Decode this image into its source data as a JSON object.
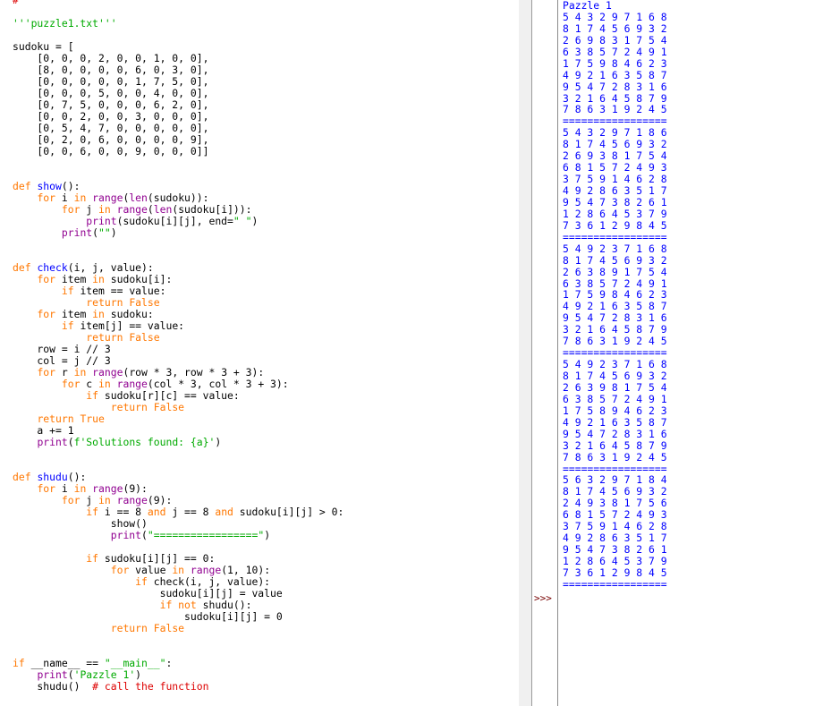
{
  "editor": {
    "code_lines": [
      [
        {
          "t": "# '''",
          "c": "com"
        }
      ],
      [
        {
          "t": "",
          "c": ""
        }
      ],
      [
        {
          "t": "'''puzzle1.txt'''",
          "c": "str"
        }
      ],
      [
        {
          "t": "",
          "c": ""
        }
      ],
      [
        {
          "t": "sudoku = [",
          "c": ""
        }
      ],
      [
        {
          "t": "    [0, 0, 0, 2, 0, 0, 1, 0, 0],",
          "c": ""
        }
      ],
      [
        {
          "t": "    [8, 0, 0, 0, 0, 6, 0, 3, 0],",
          "c": ""
        }
      ],
      [
        {
          "t": "    [0, 0, 0, 0, 0, 1, 7, 5, 0],",
          "c": ""
        }
      ],
      [
        {
          "t": "    [0, 0, 0, 5, 0, 0, 4, 0, 0],",
          "c": ""
        }
      ],
      [
        {
          "t": "    [0, 7, 5, 0, 0, 0, 6, 2, 0],",
          "c": ""
        }
      ],
      [
        {
          "t": "    [0, 0, 2, 0, 0, 3, 0, 0, 0],",
          "c": ""
        }
      ],
      [
        {
          "t": "    [0, 5, 4, 7, 0, 0, 0, 0, 0],",
          "c": ""
        }
      ],
      [
        {
          "t": "    [0, 2, 0, 6, 0, 0, 0, 0, 9],",
          "c": ""
        }
      ],
      [
        {
          "t": "    [0, 0, 6, 0, 0, 9, 0, 0, 0]]",
          "c": ""
        }
      ],
      [
        {
          "t": "",
          "c": ""
        }
      ],
      [
        {
          "t": "",
          "c": ""
        }
      ],
      [
        {
          "t": "def",
          "c": "kw"
        },
        {
          "t": " ",
          "c": ""
        },
        {
          "t": "show",
          "c": "def"
        },
        {
          "t": "():",
          "c": ""
        }
      ],
      [
        {
          "t": "    ",
          "c": ""
        },
        {
          "t": "for",
          "c": "kw"
        },
        {
          "t": " i ",
          "c": ""
        },
        {
          "t": "in",
          "c": "kw"
        },
        {
          "t": " ",
          "c": ""
        },
        {
          "t": "range",
          "c": "bi"
        },
        {
          "t": "(",
          "c": ""
        },
        {
          "t": "len",
          "c": "bi"
        },
        {
          "t": "(sudoku)):",
          "c": ""
        }
      ],
      [
        {
          "t": "        ",
          "c": ""
        },
        {
          "t": "for",
          "c": "kw"
        },
        {
          "t": " j ",
          "c": ""
        },
        {
          "t": "in",
          "c": "kw"
        },
        {
          "t": " ",
          "c": ""
        },
        {
          "t": "range",
          "c": "bi"
        },
        {
          "t": "(",
          "c": ""
        },
        {
          "t": "len",
          "c": "bi"
        },
        {
          "t": "(sudoku[i])):",
          "c": ""
        }
      ],
      [
        {
          "t": "            ",
          "c": ""
        },
        {
          "t": "print",
          "c": "bi"
        },
        {
          "t": "(sudoku[i][j], end=",
          "c": ""
        },
        {
          "t": "\" \"",
          "c": "str"
        },
        {
          "t": ")",
          "c": ""
        }
      ],
      [
        {
          "t": "        ",
          "c": ""
        },
        {
          "t": "print",
          "c": "bi"
        },
        {
          "t": "(",
          "c": ""
        },
        {
          "t": "\"\"",
          "c": "str"
        },
        {
          "t": ")",
          "c": ""
        }
      ],
      [
        {
          "t": "",
          "c": ""
        }
      ],
      [
        {
          "t": "",
          "c": ""
        }
      ],
      [
        {
          "t": "def",
          "c": "kw"
        },
        {
          "t": " ",
          "c": ""
        },
        {
          "t": "check",
          "c": "def"
        },
        {
          "t": "(i, j, value):",
          "c": ""
        }
      ],
      [
        {
          "t": "    ",
          "c": ""
        },
        {
          "t": "for",
          "c": "kw"
        },
        {
          "t": " item ",
          "c": ""
        },
        {
          "t": "in",
          "c": "kw"
        },
        {
          "t": " sudoku[i]:",
          "c": ""
        }
      ],
      [
        {
          "t": "        ",
          "c": ""
        },
        {
          "t": "if",
          "c": "kw"
        },
        {
          "t": " item == value:",
          "c": ""
        }
      ],
      [
        {
          "t": "            ",
          "c": ""
        },
        {
          "t": "return",
          "c": "kw"
        },
        {
          "t": " ",
          "c": ""
        },
        {
          "t": "False",
          "c": "kw"
        }
      ],
      [
        {
          "t": "    ",
          "c": ""
        },
        {
          "t": "for",
          "c": "kw"
        },
        {
          "t": " item ",
          "c": ""
        },
        {
          "t": "in",
          "c": "kw"
        },
        {
          "t": " sudoku:",
          "c": ""
        }
      ],
      [
        {
          "t": "        ",
          "c": ""
        },
        {
          "t": "if",
          "c": "kw"
        },
        {
          "t": " item[j] == value:",
          "c": ""
        }
      ],
      [
        {
          "t": "            ",
          "c": ""
        },
        {
          "t": "return",
          "c": "kw"
        },
        {
          "t": " ",
          "c": ""
        },
        {
          "t": "False",
          "c": "kw"
        }
      ],
      [
        {
          "t": "    row = i // 3",
          "c": ""
        }
      ],
      [
        {
          "t": "    col = j // 3",
          "c": ""
        }
      ],
      [
        {
          "t": "    ",
          "c": ""
        },
        {
          "t": "for",
          "c": "kw"
        },
        {
          "t": " r ",
          "c": ""
        },
        {
          "t": "in",
          "c": "kw"
        },
        {
          "t": " ",
          "c": ""
        },
        {
          "t": "range",
          "c": "bi"
        },
        {
          "t": "(row * 3, row * 3 + 3):",
          "c": ""
        }
      ],
      [
        {
          "t": "        ",
          "c": ""
        },
        {
          "t": "for",
          "c": "kw"
        },
        {
          "t": " c ",
          "c": ""
        },
        {
          "t": "in",
          "c": "kw"
        },
        {
          "t": " ",
          "c": ""
        },
        {
          "t": "range",
          "c": "bi"
        },
        {
          "t": "(col * 3, col * 3 + 3):",
          "c": ""
        }
      ],
      [
        {
          "t": "            ",
          "c": ""
        },
        {
          "t": "if",
          "c": "kw"
        },
        {
          "t": " sudoku[r][c] == value:",
          "c": ""
        }
      ],
      [
        {
          "t": "                ",
          "c": ""
        },
        {
          "t": "return",
          "c": "kw"
        },
        {
          "t": " ",
          "c": ""
        },
        {
          "t": "False",
          "c": "kw"
        }
      ],
      [
        {
          "t": "    ",
          "c": ""
        },
        {
          "t": "return",
          "c": "kw"
        },
        {
          "t": " ",
          "c": ""
        },
        {
          "t": "True",
          "c": "kw"
        }
      ],
      [
        {
          "t": "    a += 1",
          "c": ""
        }
      ],
      [
        {
          "t": "    ",
          "c": ""
        },
        {
          "t": "print",
          "c": "bi"
        },
        {
          "t": "(",
          "c": ""
        },
        {
          "t": "f'Solutions found: {a}'",
          "c": "str"
        },
        {
          "t": ")",
          "c": ""
        }
      ],
      [
        {
          "t": "",
          "c": ""
        }
      ],
      [
        {
          "t": "",
          "c": ""
        }
      ],
      [
        {
          "t": "def",
          "c": "kw"
        },
        {
          "t": " ",
          "c": ""
        },
        {
          "t": "shudu",
          "c": "def"
        },
        {
          "t": "():",
          "c": ""
        }
      ],
      [
        {
          "t": "    ",
          "c": ""
        },
        {
          "t": "for",
          "c": "kw"
        },
        {
          "t": " i ",
          "c": ""
        },
        {
          "t": "in",
          "c": "kw"
        },
        {
          "t": " ",
          "c": ""
        },
        {
          "t": "range",
          "c": "bi"
        },
        {
          "t": "(9):",
          "c": ""
        }
      ],
      [
        {
          "t": "        ",
          "c": ""
        },
        {
          "t": "for",
          "c": "kw"
        },
        {
          "t": " j ",
          "c": ""
        },
        {
          "t": "in",
          "c": "kw"
        },
        {
          "t": " ",
          "c": ""
        },
        {
          "t": "range",
          "c": "bi"
        },
        {
          "t": "(9):",
          "c": ""
        }
      ],
      [
        {
          "t": "            ",
          "c": ""
        },
        {
          "t": "if",
          "c": "kw"
        },
        {
          "t": " i == 8 ",
          "c": ""
        },
        {
          "t": "and",
          "c": "kw"
        },
        {
          "t": " j == 8 ",
          "c": ""
        },
        {
          "t": "and",
          "c": "kw"
        },
        {
          "t": " sudoku[i][j] > 0:",
          "c": ""
        }
      ],
      [
        {
          "t": "                show()",
          "c": ""
        }
      ],
      [
        {
          "t": "                ",
          "c": ""
        },
        {
          "t": "print",
          "c": "bi"
        },
        {
          "t": "(",
          "c": ""
        },
        {
          "t": "\"=================\"",
          "c": "str"
        },
        {
          "t": ")",
          "c": ""
        }
      ],
      [
        {
          "t": "",
          "c": ""
        }
      ],
      [
        {
          "t": "            ",
          "c": ""
        },
        {
          "t": "if",
          "c": "kw"
        },
        {
          "t": " sudoku[i][j] == 0:",
          "c": ""
        }
      ],
      [
        {
          "t": "                ",
          "c": ""
        },
        {
          "t": "for",
          "c": "kw"
        },
        {
          "t": " value ",
          "c": ""
        },
        {
          "t": "in",
          "c": "kw"
        },
        {
          "t": " ",
          "c": ""
        },
        {
          "t": "range",
          "c": "bi"
        },
        {
          "t": "(1, 10):",
          "c": ""
        }
      ],
      [
        {
          "t": "                    ",
          "c": ""
        },
        {
          "t": "if",
          "c": "kw"
        },
        {
          "t": " check(i, j, value):",
          "c": ""
        }
      ],
      [
        {
          "t": "                        sudoku[i][j] = value",
          "c": ""
        }
      ],
      [
        {
          "t": "                        ",
          "c": ""
        },
        {
          "t": "if",
          "c": "kw"
        },
        {
          "t": " ",
          "c": ""
        },
        {
          "t": "not",
          "c": "kw"
        },
        {
          "t": " shudu():",
          "c": ""
        }
      ],
      [
        {
          "t": "                            sudoku[i][j] = 0",
          "c": ""
        }
      ],
      [
        {
          "t": "                ",
          "c": ""
        },
        {
          "t": "return",
          "c": "kw"
        },
        {
          "t": " ",
          "c": ""
        },
        {
          "t": "False",
          "c": "kw"
        }
      ],
      [
        {
          "t": "",
          "c": ""
        }
      ],
      [
        {
          "t": "",
          "c": ""
        }
      ],
      [
        {
          "t": "if",
          "c": "kw"
        },
        {
          "t": " __name__ == ",
          "c": ""
        },
        {
          "t": "\"__main__\"",
          "c": "str"
        },
        {
          "t": ":",
          "c": ""
        }
      ],
      [
        {
          "t": "    ",
          "c": ""
        },
        {
          "t": "print",
          "c": "bi"
        },
        {
          "t": "(",
          "c": ""
        },
        {
          "t": "'Pazzle 1'",
          "c": "str"
        },
        {
          "t": ")",
          "c": ""
        }
      ],
      [
        {
          "t": "    shudu()  ",
          "c": ""
        },
        {
          "t": "# call the function",
          "c": "com"
        }
      ]
    ]
  },
  "shell": {
    "prompt": ">>>",
    "output_lines": [
      "Pazzle 1",
      "5 4 3 2 9 7 1 6 8",
      "8 1 7 4 5 6 9 3 2",
      "2 6 9 8 3 1 7 5 4",
      "6 3 8 5 7 2 4 9 1",
      "1 7 5 9 8 4 6 2 3",
      "4 9 2 1 6 3 5 8 7",
      "9 5 4 7 2 8 3 1 6",
      "3 2 1 6 4 5 8 7 9",
      "7 8 6 3 1 9 2 4 5",
      "=================",
      "5 4 3 2 9 7 1 8 6",
      "8 1 7 4 5 6 9 3 2",
      "2 6 9 3 8 1 7 5 4",
      "6 8 1 5 7 2 4 9 3",
      "3 7 5 9 1 4 6 2 8",
      "4 9 2 8 6 3 5 1 7",
      "9 5 4 7 3 8 2 6 1",
      "1 2 8 6 4 5 3 7 9",
      "7 3 6 1 2 9 8 4 5",
      "=================",
      "5 4 9 2 3 7 1 6 8",
      "8 1 7 4 5 6 9 3 2",
      "2 6 3 8 9 1 7 5 4",
      "6 3 8 5 7 2 4 9 1",
      "1 7 5 9 8 4 6 2 3",
      "4 9 2 1 6 3 5 8 7",
      "9 5 4 7 2 8 3 1 6",
      "3 2 1 6 4 5 8 7 9",
      "7 8 6 3 1 9 2 4 5",
      "=================",
      "5 4 9 2 3 7 1 6 8",
      "8 1 7 4 5 6 9 3 2",
      "2 6 3 9 8 1 7 5 4",
      "6 3 8 5 7 2 4 9 1",
      "1 7 5 8 9 4 6 2 3",
      "4 9 2 1 6 3 5 8 7",
      "9 5 4 7 2 8 3 1 6",
      "3 2 1 6 4 5 8 7 9",
      "7 8 6 3 1 9 2 4 5",
      "=================",
      "5 6 3 2 9 7 1 8 4",
      "8 1 7 4 5 6 9 3 2",
      "2 4 9 3 8 1 7 5 6",
      "6 8 1 5 7 2 4 9 3",
      "3 7 5 9 1 4 6 2 8",
      "4 9 2 8 6 3 5 1 7",
      "9 5 4 7 3 8 2 6 1",
      "1 2 8 6 4 5 3 7 9",
      "7 3 6 1 2 9 8 4 5",
      "================="
    ]
  }
}
